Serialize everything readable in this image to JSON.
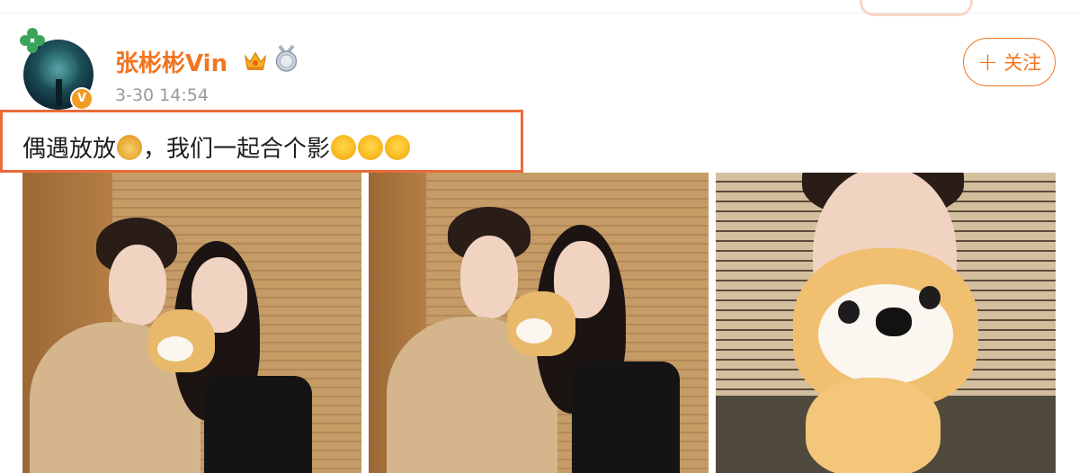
{
  "post": {
    "username": "张彬彬Vin",
    "timestamp": "3-30 14:54",
    "follow_label": "关注",
    "follow_plus": "+",
    "verified_mark": "V",
    "text_before_emoji": "偶遇放放",
    "text_after_emoji": "，我们一起合个影",
    "badges": [
      "crown-icon",
      "medal-icon"
    ],
    "emojis": [
      "doge-icon",
      "hug-icon",
      "hug-icon",
      "hug-icon"
    ]
  },
  "photos": [
    {
      "name": "post-photo-1"
    },
    {
      "name": "post-photo-2"
    },
    {
      "name": "post-photo-3"
    }
  ],
  "colors": {
    "accent": "#f27521",
    "highlight_box": "#ea6a38",
    "timestamp": "#9a9a9a",
    "text": "#1e1e1e"
  }
}
